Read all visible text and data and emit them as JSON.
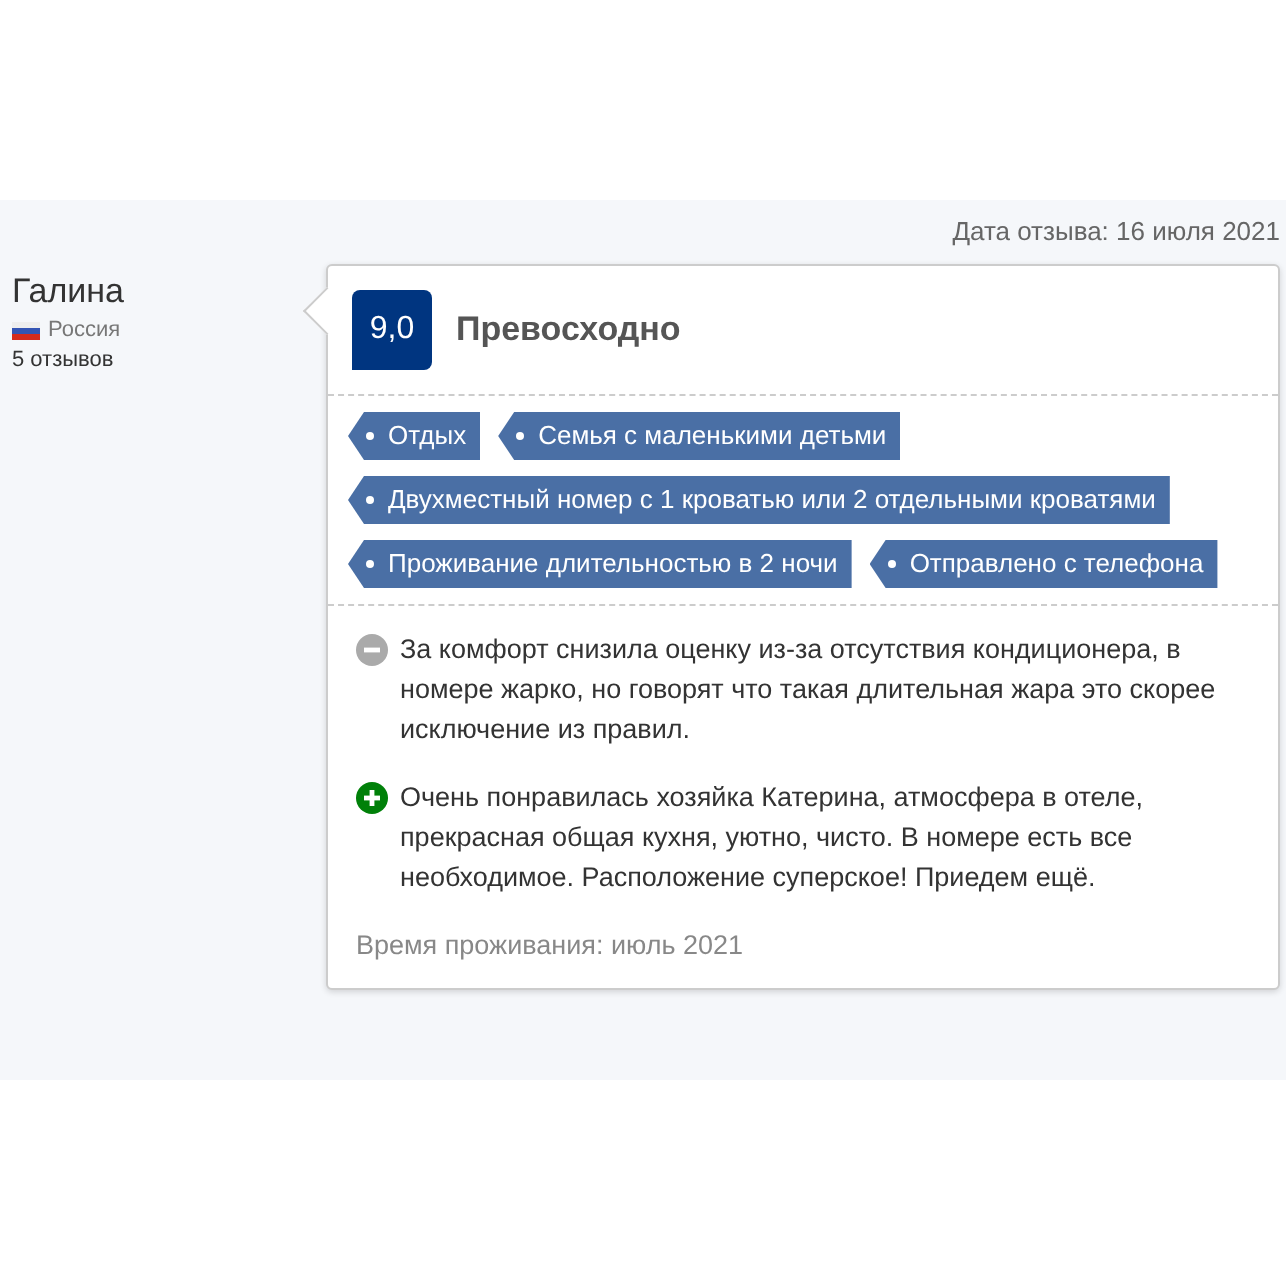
{
  "review_date": "Дата отзыва: 16 июля 2021",
  "reviewer": {
    "name": "Галина",
    "country": "Россия",
    "reviews_count": "5 отзывов"
  },
  "score": {
    "value": "9,0",
    "label": "Превосходно"
  },
  "tags": [
    [
      "Отдых",
      "Семья с маленькими детьми"
    ],
    [
      "Двухместный номер с 1 кроватью или 2 отдельными кроватями"
    ],
    [
      "Проживание длительностью в 2 ночи",
      "Отправлено с телефона"
    ]
  ],
  "comments": [
    {
      "kind": "negative",
      "text": "За комфорт снизила оценку из-за отсутствия кондиционера, в номере жарко, но говорят что такая длительная жара это скорее исключение из правил."
    },
    {
      "kind": "positive",
      "text": "Очень понравилась хозяйка Катерина, атмосфера в отеле, прекрасная общая кухня, уютно, чисто. В номере есть все необходимое. Расположение суперское! Приедем ещё."
    }
  ],
  "stay_date": "Время проживания: июль 2021"
}
